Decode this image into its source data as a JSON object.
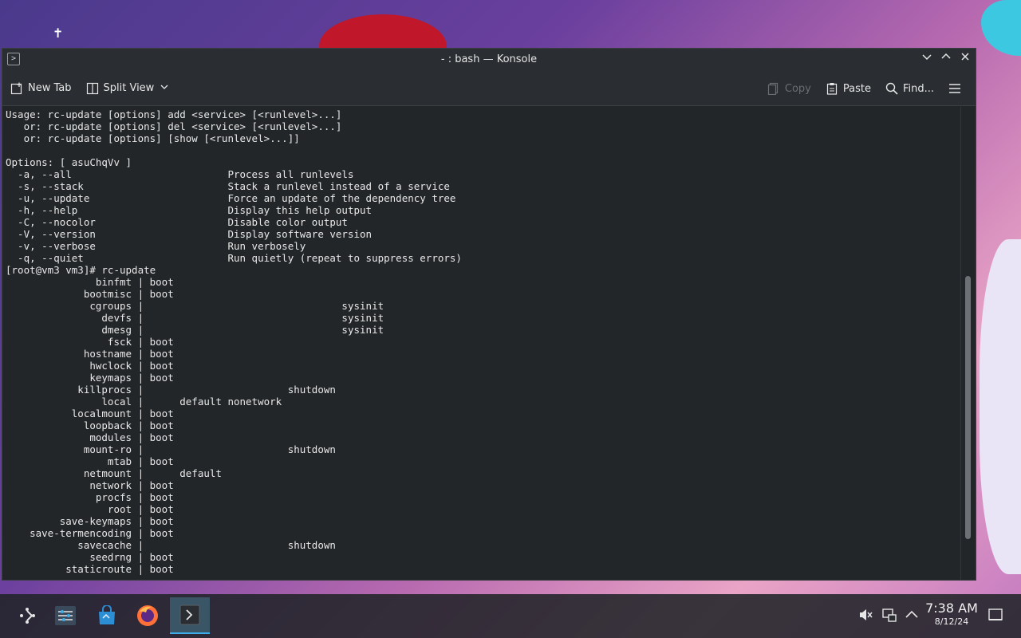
{
  "window": {
    "title": "- : bash — Konsole",
    "controls": [
      "minimize-icon",
      "maximize-icon",
      "close-icon"
    ]
  },
  "toolbar": {
    "new_tab": "New Tab",
    "split_view": "Split View",
    "copy": "Copy",
    "paste": "Paste",
    "find": "Find..."
  },
  "terminal": {
    "lines": [
      "Usage: rc-update [options] add <service> [<runlevel>...]",
      "   or: rc-update [options] del <service> [<runlevel>...]",
      "   or: rc-update [options] [show [<runlevel>...]]",
      "",
      "Options: [ asuChqVv ]",
      "  -a, --all                          Process all runlevels",
      "  -s, --stack                        Stack a runlevel instead of a service",
      "  -u, --update                       Force an update of the dependency tree",
      "  -h, --help                         Display this help output",
      "  -C, --nocolor                      Disable color output",
      "  -V, --version                      Display software version",
      "  -v, --verbose                      Run verbosely",
      "  -q, --quiet                        Run quietly (repeat to suppress errors)",
      "[root@vm3 vm3]# rc-update",
      "               binfmt | boot",
      "             bootmisc | boot",
      "              cgroups |                                 sysinit",
      "                devfs |                                 sysinit",
      "                dmesg |                                 sysinit",
      "                 fsck | boot",
      "             hostname | boot",
      "              hwclock | boot",
      "              keymaps | boot",
      "            killprocs |                        shutdown",
      "                local |      default nonetwork",
      "           localmount | boot",
      "             loopback | boot",
      "              modules | boot",
      "             mount-ro |                        shutdown",
      "                 mtab | boot",
      "             netmount |      default",
      "              network | boot",
      "               procfs | boot",
      "                 root | boot",
      "         save-keymaps | boot",
      "    save-termencoding | boot",
      "            savecache |                        shutdown",
      "              seedrng | boot",
      "          staticroute | boot"
    ]
  },
  "taskbar": {
    "items": [
      "application-launcher-icon",
      "system-settings-icon",
      "discover-store-icon",
      "firefox-icon",
      "konsole-icon"
    ],
    "time": "7:38 AM",
    "date": "8/12/24"
  },
  "colors": {
    "accent": "#3daee9",
    "terminal_bg": "#232629",
    "titlebar_bg": "#2a2e32"
  }
}
